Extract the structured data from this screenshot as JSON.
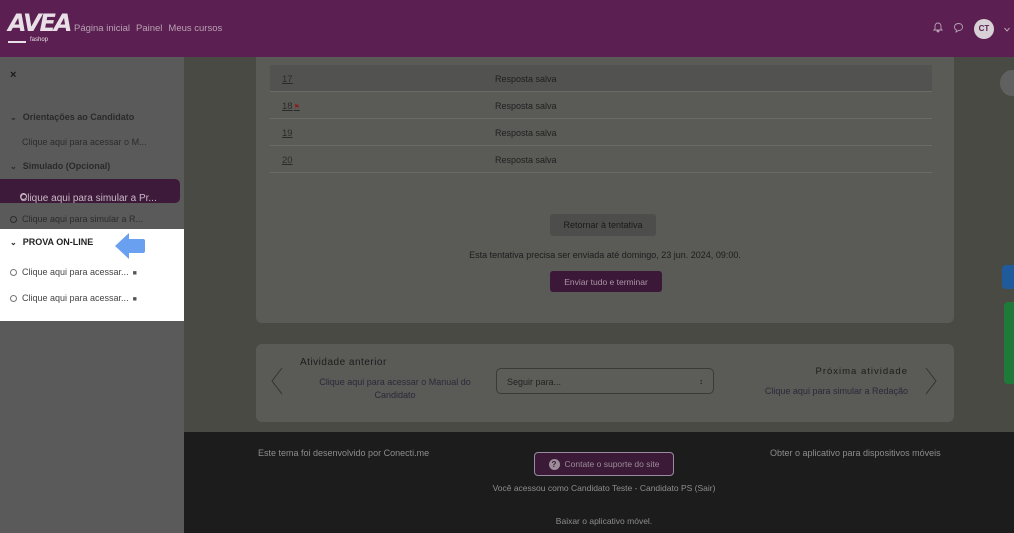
{
  "header": {
    "logo_text": "AVEA",
    "logo_sub": "fashop",
    "nav": [
      "Página inicial",
      "Painel",
      "Meus cursos"
    ],
    "avatar_initials": "CT",
    "icons": [
      "bell-icon",
      "chat-icon",
      "chevron-down-icon"
    ]
  },
  "sidebar": {
    "close_icon": "×",
    "section1": "Orientações ao Candidato",
    "section1_item": "Clique aqui para acessar o M...",
    "section2": "Simulado (Opcional)",
    "section2_active": "Clique aqui para simular a Pr...",
    "section2_item": "Clique aqui para simular a R...",
    "section3": "PROVA ON-LINE",
    "section3_items": [
      "Clique aqui para acessar...",
      "Clique aqui para acessar..."
    ]
  },
  "table": {
    "rows": [
      {
        "num": "17",
        "status": "Resposta salva",
        "flag": false
      },
      {
        "num": "18",
        "status": "Resposta salva",
        "flag": true
      },
      {
        "num": "19",
        "status": "Resposta salva",
        "flag": false
      },
      {
        "num": "20",
        "status": "Resposta salva",
        "flag": false
      }
    ]
  },
  "actions": {
    "return_label": "Retornar à tentativa",
    "deadline": "Esta tentativa precisa ser enviada até domingo, 23 jun. 2024, 09:00.",
    "submit_label": "Enviar tudo e terminar"
  },
  "activity_nav": {
    "prev_title": "Atividade anterior",
    "prev_link": "Clique aqui para acessar o Manual do Candidato",
    "select_placeholder": "Seguir para...",
    "next_title": "Próxima atividade",
    "next_link": "Clique aqui para simular a Redação"
  },
  "footer": {
    "left": "Este tema foi desenvolvido por Conecti.me",
    "support": "Contate o suporte do site",
    "login": "Você acessou como Candidato Teste - Candidato PS (Sair)",
    "app": "Baixar o aplicativo móvel.",
    "right": "Obter o aplicativo para dispositivos móveis"
  },
  "colors": {
    "topbar": "#5b1f52",
    "arrow": "#6aa0f0",
    "highlight_bg": "#ffffff"
  }
}
